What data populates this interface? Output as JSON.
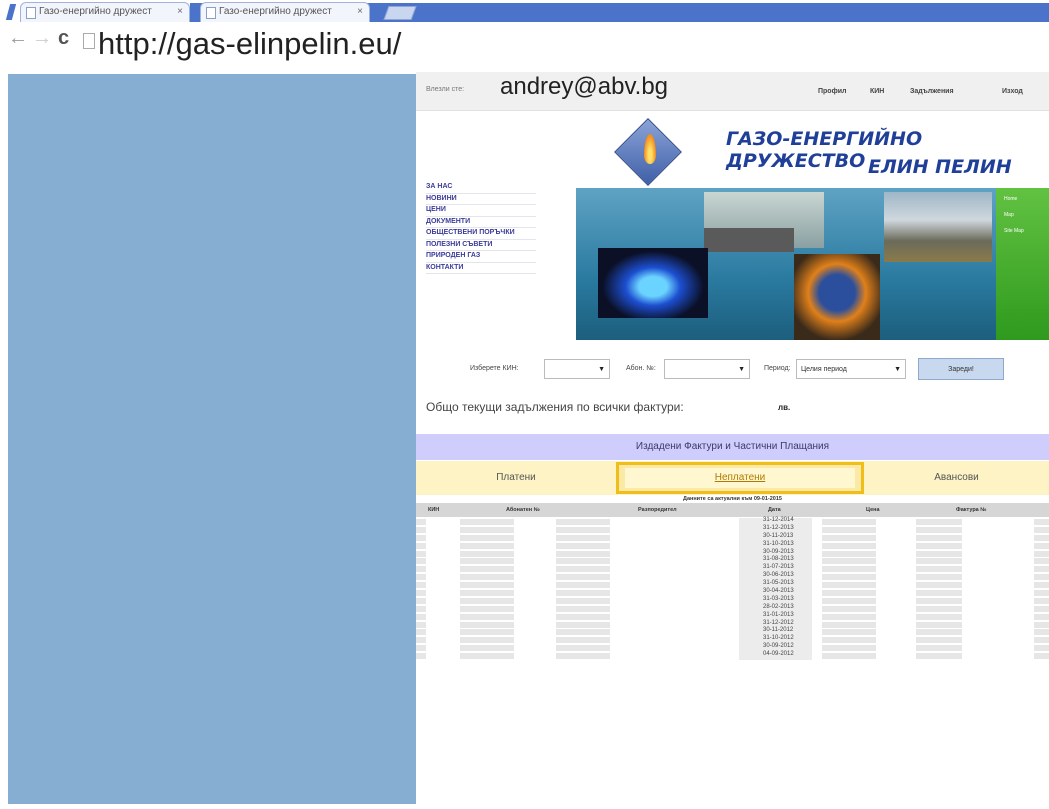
{
  "browser": {
    "tabs": [
      {
        "title": "Газо-енергийно дружест"
      },
      {
        "title": "Газо-енергийно дружест"
      }
    ],
    "url": "http://gas-elinpelin.eu/",
    "nav": {
      "back": "←",
      "forward": "→",
      "reload": "c"
    }
  },
  "site": {
    "login_label": "Влезли сте:",
    "login_email": "andrey@abv.bg",
    "top_links": [
      "Профил",
      "КИН",
      "Задължения",
      "Изход"
    ],
    "company_line1": "ГАЗО-ЕНЕРГИЙНО ДРУЖЕСТВО",
    "company_line2": "ЕЛИН ПЕЛИН",
    "sidenav": [
      "ЗА НАС",
      "НОВИНИ",
      "ЦЕНИ",
      "ДОКУМЕНТИ",
      "ОБЩЕСТВЕНИ ПОРЪЧКИ",
      "ПОЛЕЗНИ СЪВЕТИ",
      "ПРИРОДЕН ГАЗ",
      "КОНТАКТИ"
    ],
    "green_links": [
      "Home",
      "Map",
      "Site Map"
    ],
    "form": {
      "kin_label": "Изберете КИН:",
      "abon_label": "Абон. №:",
      "period_label": "Период:",
      "period_value": "Целия период",
      "load_button": "Зареди!"
    },
    "total_label": "Общо текущи задължения по всички фактури:",
    "total_currency": "лв.",
    "invoices": {
      "header": "Издадени Фактури и Частични Плащания",
      "tabs": [
        "Платени",
        "Неплатени",
        "Авансови"
      ],
      "active_tab": "Неплатени",
      "note": "Данните са актуални към 09-01-2015",
      "columns": [
        "КИН",
        "Абонатен №",
        "Разпоредител",
        "Дата",
        "Цена",
        "Фактура №"
      ],
      "dates": [
        "31-12-2014",
        "31-12-2013",
        "30-11-2013",
        "31-10-2013",
        "30-09-2013",
        "31-08-2013",
        "31-07-2013",
        "30-06-2013",
        "31-05-2013",
        "30-04-2013",
        "31-03-2013",
        "28-02-2013",
        "31-01-2013",
        "31-12-2012",
        "30-11-2012",
        "31-10-2012",
        "30-09-2012",
        "04-09-2012"
      ]
    }
  },
  "colors": {
    "chrome_blue": "#4b73c9",
    "left_pane": "#86aed3",
    "brand_blue": "#1f3f98",
    "invoice_header": "#cfcdfb",
    "tabs_bg": "#fdf3c4",
    "active_tab_border": "#f0be1a"
  }
}
